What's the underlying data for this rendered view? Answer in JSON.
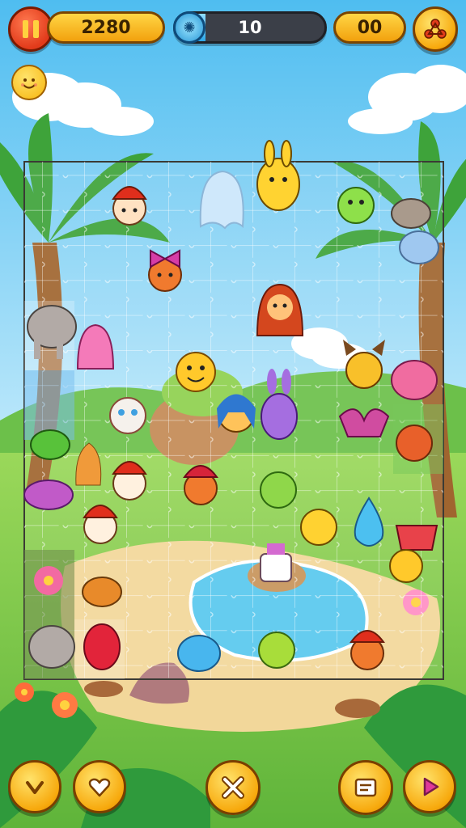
{
  "hud": {
    "score": "2280",
    "progress_value": "10",
    "progress_fraction": 0.2,
    "coins": "00"
  },
  "colors": {
    "sky": "#5cc6f2",
    "grass": "#86cf4f",
    "hud_gold": "#f6b81c",
    "hud_dark": "#3b3f48",
    "button_gold": "#f7a90d",
    "pause_red": "#e23b1b"
  },
  "icons": {
    "pause": "pause-icon",
    "progress": "fan-icon",
    "menu": "share-icon",
    "mood": "smiley-icon",
    "back": "chevron-down-icon",
    "hint": "heart-arrow-icon",
    "shuffle": "cross-pieces-icon",
    "pieces": "scroll-icon",
    "play": "play-icon"
  }
}
